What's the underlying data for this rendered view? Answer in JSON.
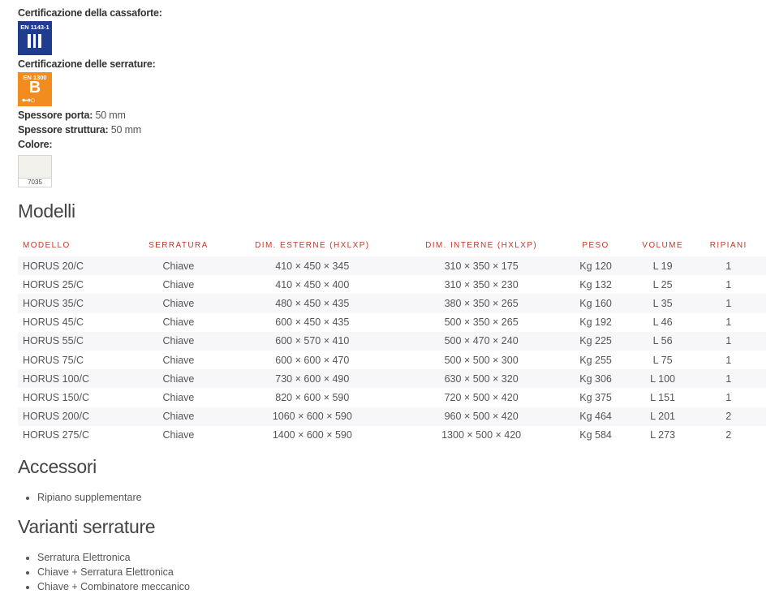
{
  "specs": {
    "safe_cert_label": "Certificazione della cassaforte:",
    "safe_badge": {
      "standard": "EN 1143-1",
      "grade": "III",
      "color": "#1f3c8f"
    },
    "lock_cert_label": "Certificazione delle serrature:",
    "lock_badge": {
      "standard": "EN 1300",
      "grade": "B",
      "key_glyph": "⊷○",
      "color": "#f28c1e"
    },
    "door_thickness_label": "Spessore porta:",
    "door_thickness_value": "50 mm",
    "body_thickness_label": "Spessore struttura:",
    "body_thickness_value": "50 mm",
    "color_label": "Colore:",
    "color_code": "7035"
  },
  "models": {
    "title": "Modelli",
    "header_color": "#c0392b",
    "headers": [
      "MODELLO",
      "SERRATURA",
      "DIM. ESTERNE (HXLXP)",
      "DIM. INTERNE (HXLXP)",
      "PESO",
      "VOLUME",
      "RIPIANI"
    ],
    "rows": [
      [
        "HORUS 20/C",
        "Chiave",
        "410 × 450 × 345",
        "310 × 350 × 175",
        "Kg 120",
        "L 19",
        "1"
      ],
      [
        "HORUS 25/C",
        "Chiave",
        "410 × 450 × 400",
        "310 × 350 × 230",
        "Kg 132",
        "L 25",
        "1"
      ],
      [
        "HORUS 35/C",
        "Chiave",
        "480 × 450 × 435",
        "380 × 350 × 265",
        "Kg 160",
        "L 35",
        "1"
      ],
      [
        "HORUS 45/C",
        "Chiave",
        "600 × 450 × 435",
        "500 × 350 × 265",
        "Kg 192",
        "L 46",
        "1"
      ],
      [
        "HORUS 55/C",
        "Chiave",
        "600 × 570 × 410",
        "500 × 470 × 240",
        "Kg 225",
        "L 56",
        "1"
      ],
      [
        "HORUS 75/C",
        "Chiave",
        "600 × 600 × 470",
        "500 × 500 × 300",
        "Kg 255",
        "L 75",
        "1"
      ],
      [
        "HORUS 100/C",
        "Chiave",
        "730 × 600 × 490",
        "630 × 500 × 320",
        "Kg 306",
        "L 100",
        "1"
      ],
      [
        "HORUS 150/C",
        "Chiave",
        "820 × 600 × 590",
        "720 × 500 × 420",
        "Kg 375",
        "L 151",
        "1"
      ],
      [
        "HORUS 200/C",
        "Chiave",
        "1060 × 600 × 590",
        "960 × 500 × 420",
        "Kg 464",
        "L 201",
        "2"
      ],
      [
        "HORUS 275/C",
        "Chiave",
        "1400 × 600 × 590",
        "1300 × 500 × 420",
        "Kg 584",
        "L 273",
        "2"
      ]
    ]
  },
  "accessories": {
    "title": "Accessori",
    "items": [
      "Ripiano supplementare"
    ]
  },
  "lock_variants": {
    "title": "Varianti serrature",
    "items": [
      "Serratura Elettronica",
      "Chiave + Serratura Elettronica",
      "Chiave + Combinatore meccanico"
    ]
  }
}
